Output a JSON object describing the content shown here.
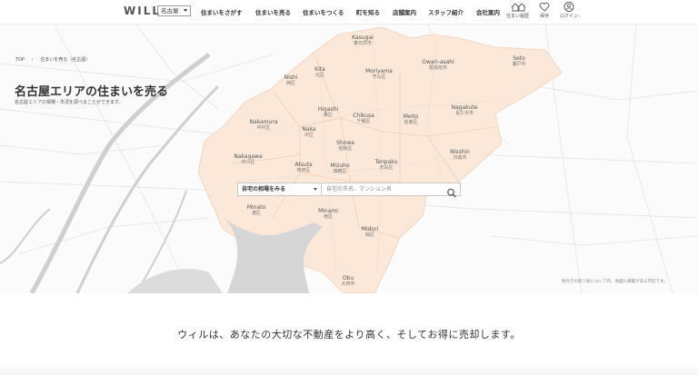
{
  "header": {
    "logo": "WILL",
    "area": "名古屋",
    "nav": [
      "住まいをさがす",
      "住まいを売る",
      "住まいをつくる",
      "町を知る",
      "店舗案内",
      "スタッフ紹介",
      "会社案内"
    ],
    "icons": [
      {
        "name": "house-icon",
        "label": "住まい履歴"
      },
      {
        "name": "heart-icon",
        "label": "保存"
      },
      {
        "name": "user-icon",
        "label": "ログイン"
      }
    ]
  },
  "breadcrumb": [
    "TOP",
    "住まいを売る（名古屋）"
  ],
  "title": "名古屋エリアの住まいを売る",
  "subtitle": "名古屋エリアの相場・市況を調べることができます。",
  "cities": [
    {
      "en": "Kasugai",
      "jp": "春日井市"
    },
    {
      "en": "Owari-asahi",
      "jp": "尾張旭市"
    },
    {
      "en": "Seto",
      "jp": "瀬戸市"
    },
    {
      "en": "Nishi",
      "jp": "西区"
    },
    {
      "en": "Kita",
      "jp": "北区"
    },
    {
      "en": "Moriyama",
      "jp": "守山区"
    },
    {
      "en": "Higashi",
      "jp": "東区"
    },
    {
      "en": "Nagakute",
      "jp": "長久手市"
    },
    {
      "en": "Nakamura",
      "jp": "中村区"
    },
    {
      "en": "Chikusa",
      "jp": "千種区"
    },
    {
      "en": "Meito",
      "jp": "名東区"
    },
    {
      "en": "Naka",
      "jp": "中区"
    },
    {
      "en": "Showa",
      "jp": "昭和区"
    },
    {
      "en": "Nisshin",
      "jp": "日進市"
    },
    {
      "en": "Nakagawa",
      "jp": "中川区"
    },
    {
      "en": "Atsuta",
      "jp": "熱田区"
    },
    {
      "en": "Mizuho",
      "jp": "瑞穂区"
    },
    {
      "en": "Tenpaku",
      "jp": "天白区"
    },
    {
      "en": "Minato",
      "jp": "港区"
    },
    {
      "en": "Minami",
      "jp": "南区"
    },
    {
      "en": "Midori",
      "jp": "緑区"
    },
    {
      "en": "Obu",
      "jp": "大府市"
    }
  ],
  "search": {
    "select_label": "自宅の相場をみる",
    "placeholder": "自宅の市名、マンション名"
  },
  "note": "色付きの取り扱いエリア内、地図に掲載がある市区です。",
  "tagline": "ウィルは、あなたの大切な不動産をより高く、そしてお得に売却します。",
  "colors": {
    "area_fill": "#fbe8d9",
    "water": "#d4d4d4",
    "text": "#333333"
  }
}
